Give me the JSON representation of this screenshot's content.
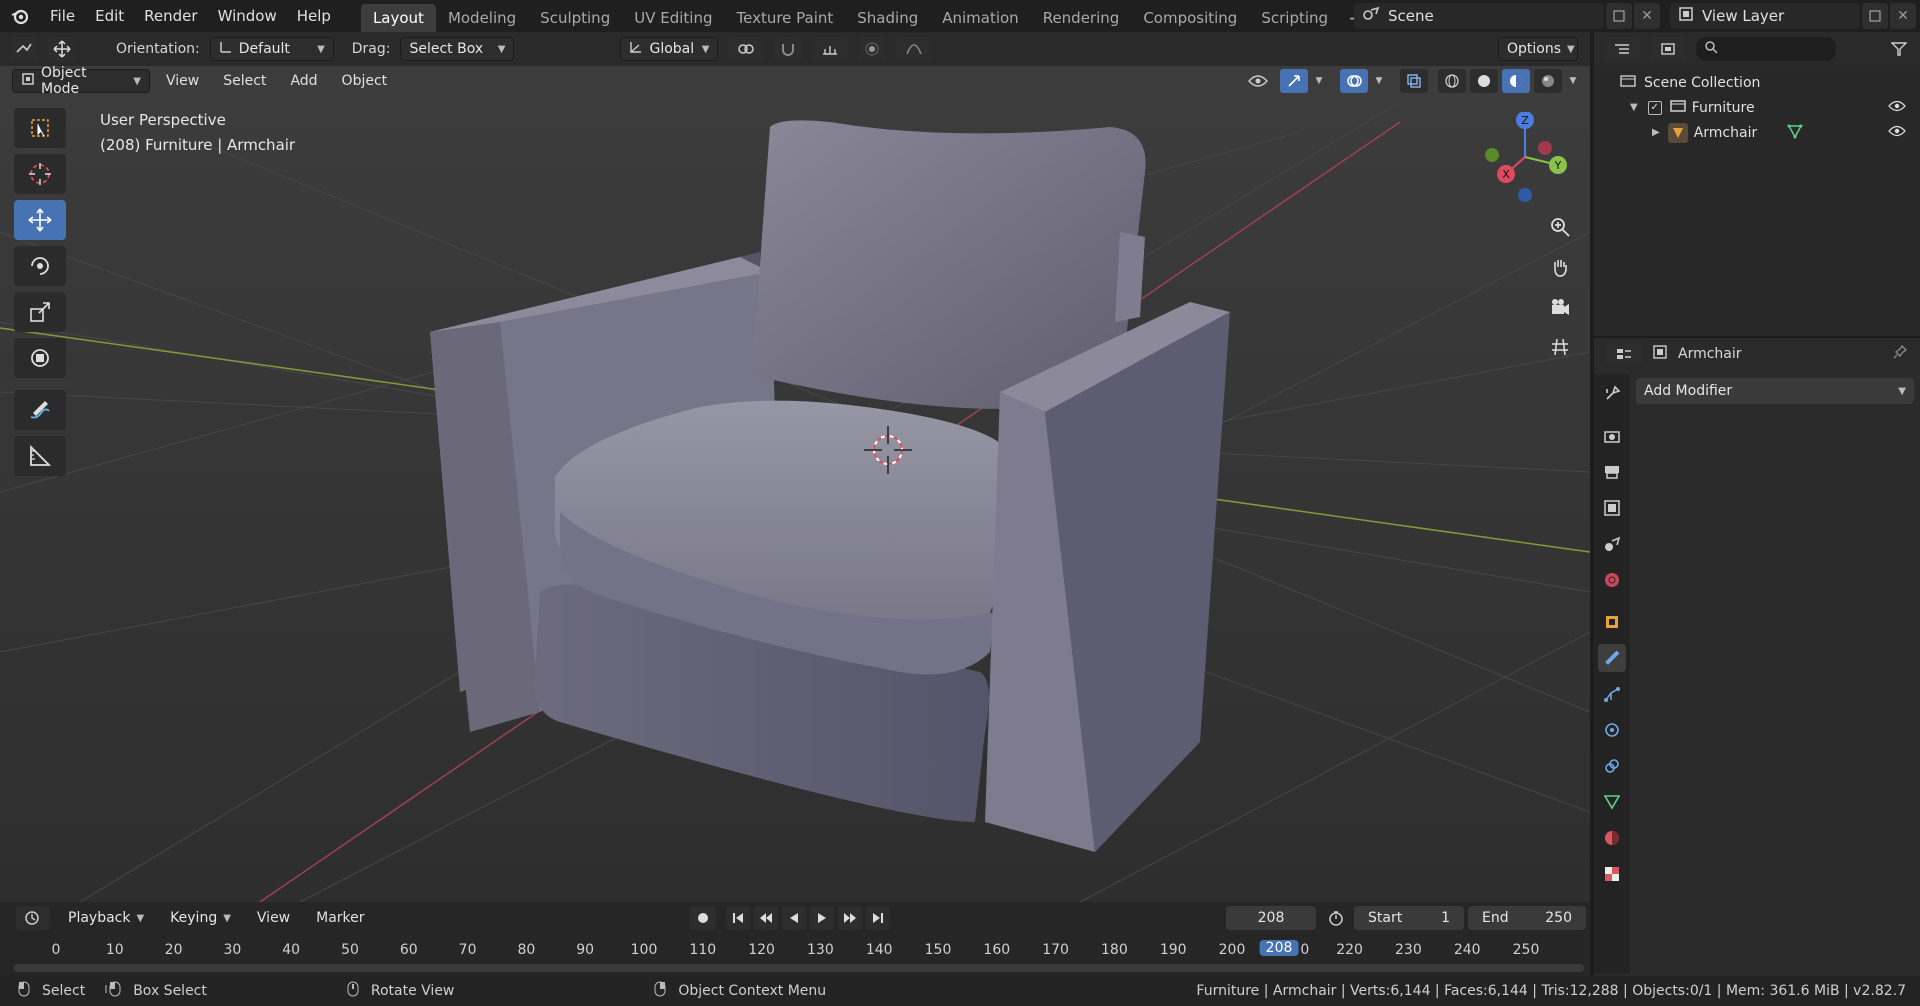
{
  "menu": {
    "file": "File",
    "edit": "Edit",
    "render": "Render",
    "window": "Window",
    "help": "Help"
  },
  "workspaces": [
    "Layout",
    "Modeling",
    "Sculpting",
    "UV Editing",
    "Texture Paint",
    "Shading",
    "Animation",
    "Rendering",
    "Compositing",
    "Scripting"
  ],
  "workspace_add": "+",
  "scene": {
    "name": "Scene",
    "view_layer": "View Layer"
  },
  "viewport": {
    "header": {
      "orientation_label": "Orientation:",
      "orientation_value": "Default",
      "drag_label": "Drag:",
      "drag_value": "Select Box",
      "transform_orientation": "Global",
      "options": "Options"
    },
    "header2": {
      "mode": "Object Mode",
      "view": "View",
      "select": "Select",
      "add": "Add",
      "object": "Object"
    },
    "overlay_line1": "User Perspective",
    "overlay_line2": "(208) Furniture | Armchair",
    "gizmo": {
      "x": "X",
      "y": "Y",
      "z": "Z"
    }
  },
  "timeline": {
    "playback": "Playback",
    "keying": "Keying",
    "view": "View",
    "marker": "Marker",
    "current_frame": "208",
    "start_label": "Start",
    "start_value": "1",
    "end_label": "End",
    "end_value": "250",
    "ticks": [
      "0",
      "10",
      "20",
      "30",
      "40",
      "50",
      "60",
      "70",
      "80",
      "90",
      "100",
      "110",
      "120",
      "130",
      "140",
      "150",
      "160",
      "170",
      "180",
      "190",
      "200",
      "210",
      "220",
      "230",
      "240",
      "250"
    ],
    "tick_210_partial": "0"
  },
  "status": {
    "select": "Select",
    "box_select": "Box Select",
    "rotate_view": "Rotate View",
    "context_menu": "Object Context Menu",
    "stats": "Furniture | Armchair | Verts:6,144 | Faces:6,144 | Tris:12,288 | Objects:0/1 | Mem: 361.6 MiB | v2.82.7"
  },
  "outliner": {
    "scene_collection": "Scene Collection",
    "collection": "Furniture",
    "object": "Armchair"
  },
  "properties": {
    "object_name": "Armchair",
    "add_modifier": "Add Modifier"
  },
  "colors": {
    "accent": "#4772b3",
    "x_axis": "#e04a5f",
    "y_axis": "#8bc34a",
    "z_axis": "#4a7fe0"
  }
}
